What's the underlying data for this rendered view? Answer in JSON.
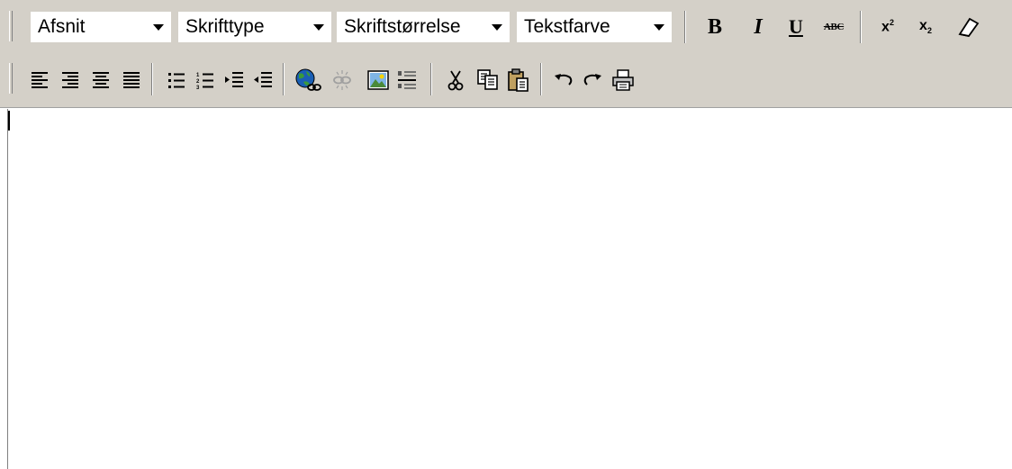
{
  "toolbar": {
    "dropdowns": {
      "paragraph": "Afsnit",
      "font": "Skrifttype",
      "font_size": "Skriftstørrelse",
      "text_color": "Tekstfarve"
    },
    "format_buttons": {
      "bold": "B",
      "italic": "I",
      "underline": "U",
      "strikethrough": "ABC"
    },
    "icons": [
      "align-left-icon",
      "align-right-icon",
      "align-center-icon",
      "align-justify-icon",
      "bulleted-list-icon",
      "numbered-list-icon",
      "indent-icon",
      "outdent-icon",
      "insert-link-icon",
      "unlink-icon",
      "insert-image-icon",
      "horizontal-rule-icon",
      "cut-icon",
      "copy-icon",
      "paste-icon",
      "undo-icon",
      "redo-icon",
      "print-icon",
      "superscript-icon",
      "subscript-icon",
      "eraser-icon"
    ]
  },
  "editor": {
    "content": ""
  },
  "colors": {
    "toolbar_bg": "#d4d0c8",
    "editor_bg": "#ffffff",
    "link_globe_blue": "#1a5fb4",
    "link_globe_green": "#3a9a3a"
  }
}
